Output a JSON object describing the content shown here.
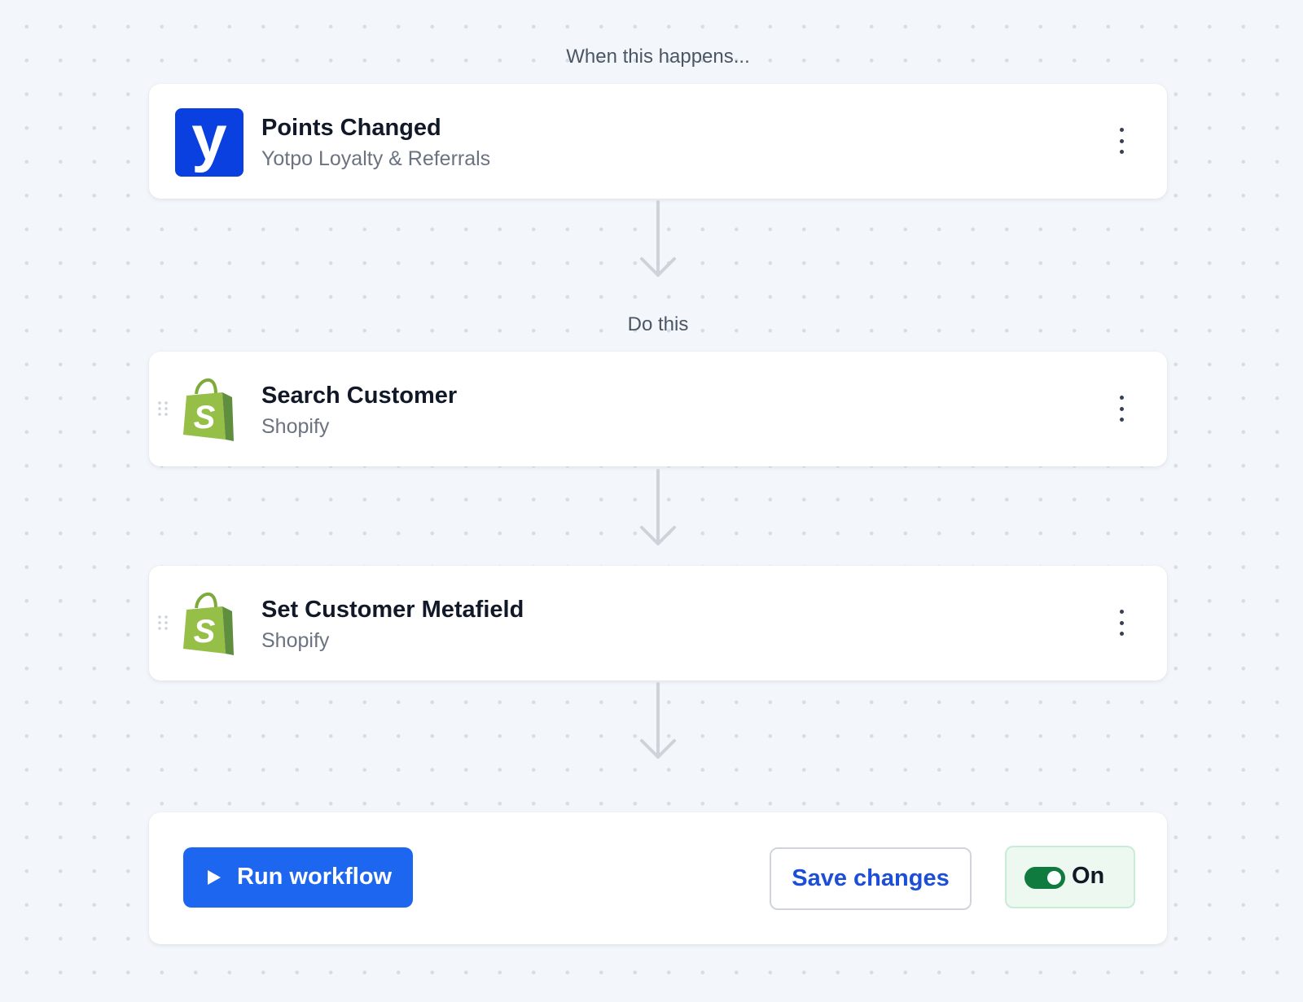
{
  "trigger_section": {
    "label": "When this happens..."
  },
  "action_section": {
    "label": "Do this"
  },
  "trigger": {
    "title": "Points Changed",
    "app": "Yotpo Loyalty & Referrals",
    "logo_letter": "y",
    "icon": "yotpo-logo"
  },
  "steps": [
    {
      "title": "Search Customer",
      "app": "Shopify",
      "icon": "shopify-bag-logo"
    },
    {
      "title": "Set Customer Metafield",
      "app": "Shopify",
      "icon": "shopify-bag-logo"
    }
  ],
  "footer": {
    "run_label": "Run workflow",
    "save_label": "Save changes",
    "toggle_label": "On",
    "toggle_on": true
  },
  "colors": {
    "primary": "#1d66f0",
    "yotpo": "#0a3fe0",
    "shopify_green": "#95bf47",
    "toggle_green": "#0f7b3f"
  }
}
